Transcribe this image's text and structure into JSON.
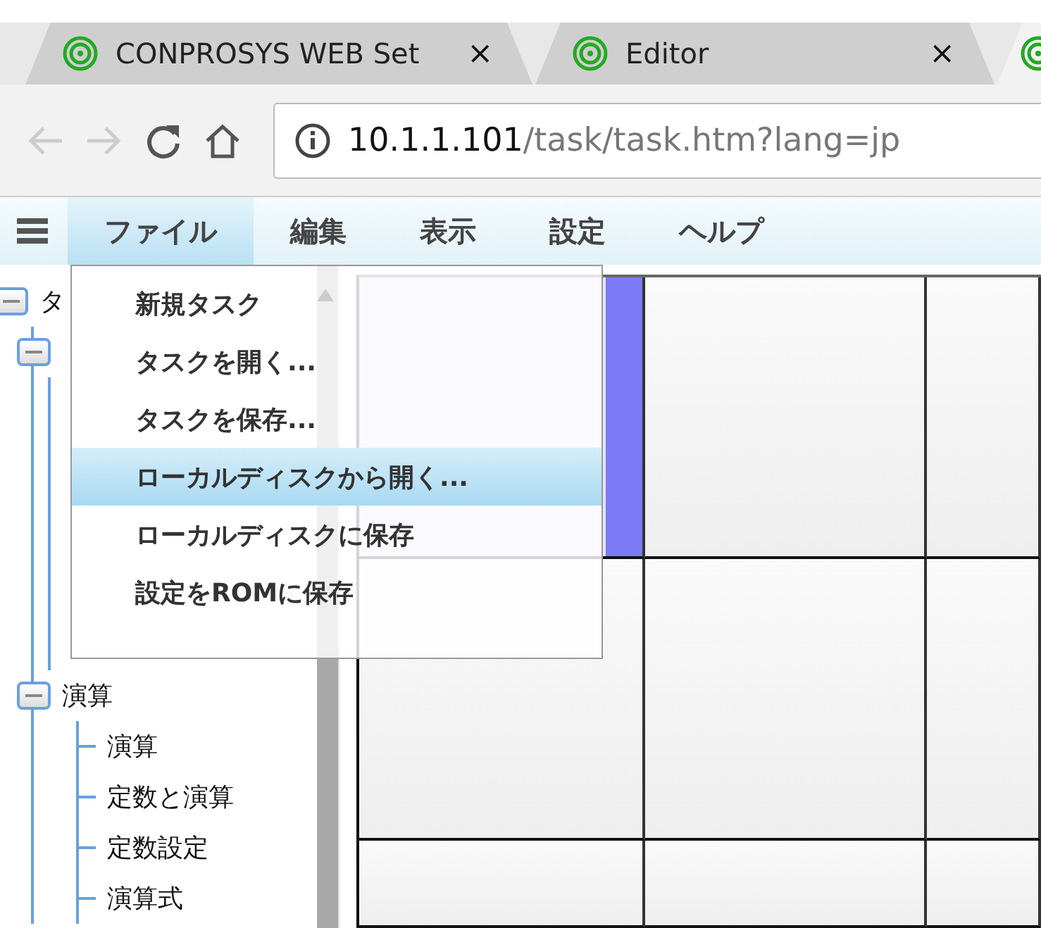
{
  "browser": {
    "tabs": [
      {
        "title": "CONPROSYS WEB Set",
        "selected": false,
        "close": "×"
      },
      {
        "title": "Editor",
        "selected": false,
        "close": "×"
      },
      {
        "selected": true
      }
    ],
    "address": {
      "host": "10.1.1.101",
      "path": "/task/task.htm?lang=jp"
    }
  },
  "menubar": {
    "items": [
      {
        "label": "ファイル",
        "selected": true
      },
      {
        "label": "編集",
        "selected": false
      },
      {
        "label": "表示",
        "selected": false
      },
      {
        "label": "設定",
        "selected": false
      },
      {
        "label": "ヘルプ",
        "selected": false
      }
    ]
  },
  "tree": [
    {
      "label": "タ",
      "expanded": true,
      "children": [
        {
          "expanded": true
        },
        {
          "label": "演算",
          "expanded": true,
          "children": [
            {
              "label": "演算"
            },
            {
              "label": "定数と演算"
            },
            {
              "label": "定数設定"
            },
            {
              "label": "演算式"
            }
          ]
        }
      ]
    }
  ],
  "menu": {
    "items": [
      {
        "label": "新規タスク",
        "selected": false
      },
      {
        "label": "タスクを開く...",
        "selected": false
      },
      {
        "label": "タスクを保存...",
        "selected": false
      },
      {
        "label": "ローカルディスクから開く...",
        "selected": true
      },
      {
        "label": "ローカルディスクに保存",
        "selected": false
      },
      {
        "label": "設定をROMに保存",
        "selected": false
      }
    ]
  },
  "canvas": {
    "cells": [
      {
        "selected": true
      },
      {
        "selected": false
      },
      {
        "selected": false
      },
      {
        "selected": false
      },
      {
        "selected": false
      },
      {
        "selected": false
      },
      {
        "selected": false
      },
      {
        "selected": false
      },
      {
        "selected": false
      }
    ]
  }
}
